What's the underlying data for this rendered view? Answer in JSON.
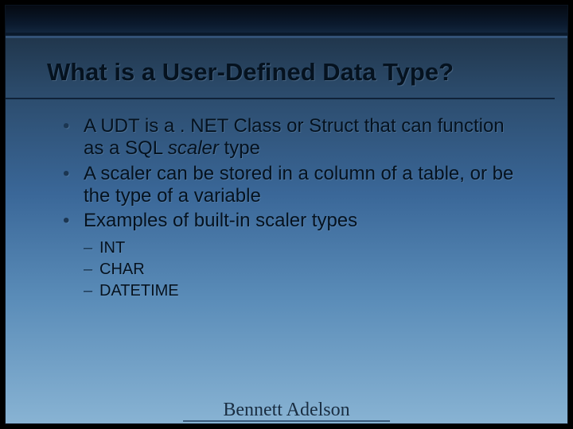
{
  "title": "What is a User-Defined Data Type?",
  "bullets": [
    {
      "pre": "A UDT is a . NET Class or Struct that can function as a SQL ",
      "em": "scaler",
      "post": " type"
    },
    {
      "text": "A scaler can be stored in a column of a table, or be the type of a variable"
    },
    {
      "text": "Examples of built-in scaler types"
    }
  ],
  "sub": [
    "INT",
    "CHAR",
    "DATETIME"
  ],
  "footer": "Bennett Adelson"
}
